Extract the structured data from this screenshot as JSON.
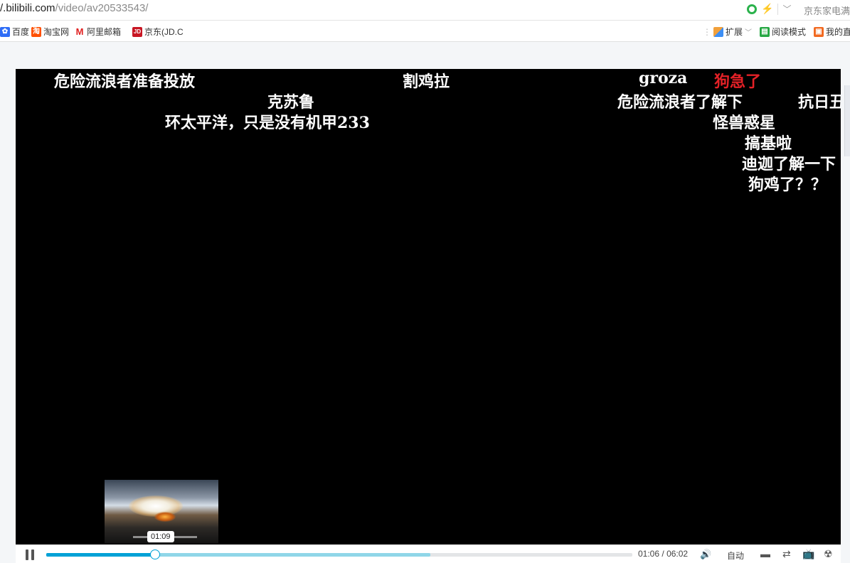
{
  "browser": {
    "url_domain": "bilibili.com",
    "url_prefix": "/.",
    "url_path": "/video/av20533543/",
    "right_label": "京东家电满"
  },
  "bookmarks": [
    {
      "label": "百度",
      "icon": "paw-icon",
      "color": "#2f6df6"
    },
    {
      "label": "淘宝网",
      "icon": "taobao-icon",
      "color": "#ff5000"
    },
    {
      "label": "阿里邮箱",
      "icon": "mail-icon",
      "color": "#e02020"
    },
    {
      "label": "京东(JD.C",
      "icon": "jd-icon",
      "color": "#c81623"
    }
  ],
  "bookmarks_right": {
    "extend": "扩展",
    "read_mode": "阅读模式",
    "mine": "我的直"
  },
  "danmaku": [
    {
      "text": "危险流浪者准备投放",
      "color": "#ffffff"
    },
    {
      "text": "割鸡拉",
      "color": "#ffffff"
    },
    {
      "text": "groza",
      "color": "#ffffff"
    },
    {
      "text": "狗急了",
      "color": "#e42127"
    },
    {
      "text": "克苏鲁",
      "color": "#ffffff"
    },
    {
      "text": "危险流浪者了解下",
      "color": "#ffffff"
    },
    {
      "text": "抗日丑",
      "color": "#ffffff"
    },
    {
      "text": "环太平洋，只是没有机甲233",
      "color": "#ffffff"
    },
    {
      "text": "怪兽惑星",
      "color": "#ffffff"
    },
    {
      "text": "搞基啦",
      "color": "#ffffff"
    },
    {
      "text": "迪迦了解一下",
      "color": "#ffffff"
    },
    {
      "text": "狗鸡了？？",
      "color": "#ffffff"
    }
  ],
  "preview": {
    "time": "01:09"
  },
  "player": {
    "current_time": "01:06",
    "separator": "/",
    "duration": "06:02",
    "quality": "自动",
    "progress_fraction": 0.186,
    "buffered_fraction": 0.655,
    "accent_color": "#00a1d6"
  }
}
